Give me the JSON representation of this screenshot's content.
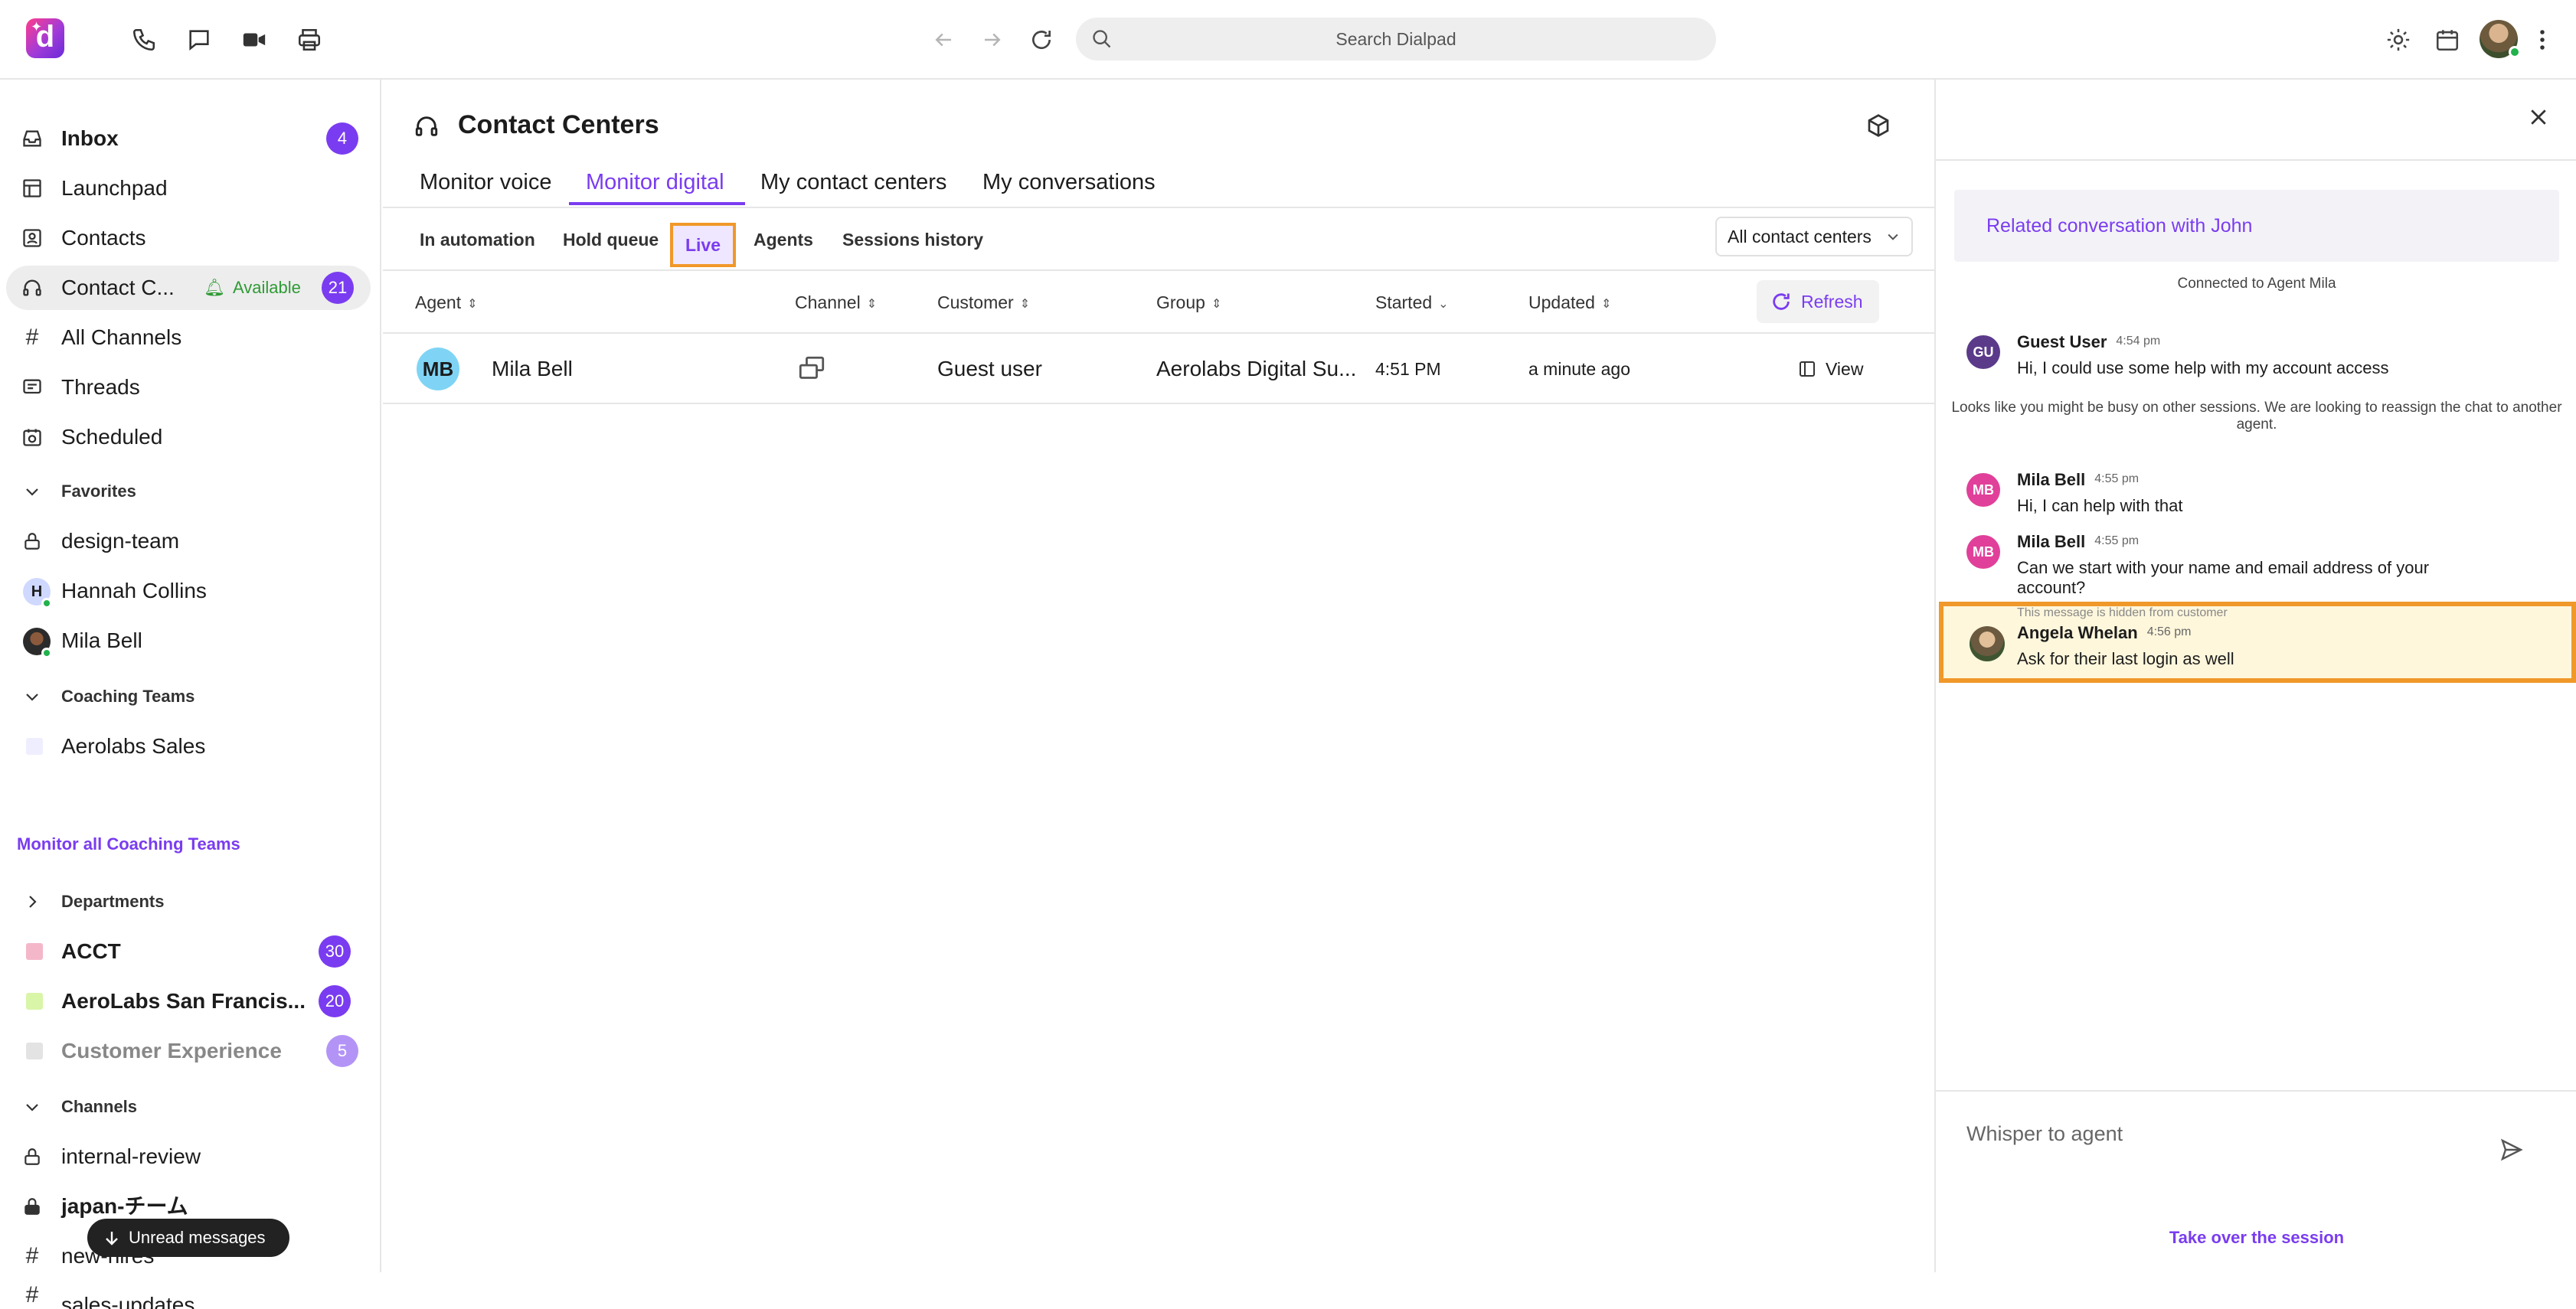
{
  "topbar": {
    "search_placeholder": "Search Dialpad",
    "logo_letter": "d",
    "icons": [
      "phone-icon",
      "message-icon",
      "video-icon",
      "print-icon",
      "back-icon",
      "forward-icon",
      "refresh-icon",
      "search-icon",
      "settings-icon",
      "calendar-icon",
      "more-icon"
    ]
  },
  "sidebar": {
    "items": [
      {
        "label": "Inbox",
        "badge": "4",
        "icon": "inbox-icon"
      },
      {
        "label": "Launchpad",
        "icon": "launchpad-icon"
      },
      {
        "label": "Contacts",
        "icon": "contacts-icon"
      },
      {
        "label": "Contact C...",
        "status": "Available",
        "badge": "21",
        "icon": "headset-icon"
      },
      {
        "label": "All Channels",
        "icon": "hash-icon"
      },
      {
        "label": "Threads",
        "icon": "threads-icon"
      },
      {
        "label": "Scheduled",
        "icon": "scheduled-icon"
      }
    ],
    "favorites": {
      "title": "Favorites",
      "items": [
        {
          "label": "design-team"
        },
        {
          "label": "Hannah Collins",
          "initial": "H"
        },
        {
          "label": "Mila Bell"
        }
      ]
    },
    "coaching": {
      "title": "Coaching Teams",
      "items": [
        {
          "label": "Aerolabs Sales"
        }
      ],
      "link": "Monitor all Coaching Teams"
    },
    "departments": {
      "title": "Departments",
      "items": [
        {
          "label": "ACCT",
          "badge": "30",
          "color": "#f4b7c9"
        },
        {
          "label": "AeroLabs San Francis...",
          "badge": "20",
          "color": "#d9f5a8"
        },
        {
          "label": "Customer Experience",
          "badge": "5",
          "color": "#e3e3e3"
        }
      ]
    },
    "channels": {
      "title": "Channels",
      "items": [
        {
          "label": "internal-review"
        },
        {
          "label": "japan-チーム"
        },
        {
          "label": "new-hires"
        },
        {
          "label": "sales-updates"
        }
      ]
    },
    "toast": "Unread messages"
  },
  "main": {
    "title": "Contact Centers",
    "tabs": [
      "Monitor voice",
      "Monitor digital",
      "My contact centers",
      "My conversations"
    ],
    "active_tab": "Monitor digital",
    "subtabs": [
      "In automation",
      "Hold queue",
      "Live",
      "Agents",
      "Sessions history"
    ],
    "active_subtab": "Live",
    "filter": "All contact centers",
    "columns": [
      "Agent",
      "Channel",
      "Customer",
      "Group",
      "Started",
      "Updated"
    ],
    "refresh_label": "Refresh",
    "rows": [
      {
        "agent_initials": "MB",
        "agent": "Mila Bell",
        "customer": "Guest user",
        "group": "Aerolabs Digital Su...",
        "started": "4:51 PM",
        "updated": "a minute ago",
        "action": "View"
      }
    ]
  },
  "panel": {
    "related": "Related conversation with John",
    "connected": "Connected to Agent Mila",
    "messages": [
      {
        "initials": "GU",
        "name": "Guest User",
        "time": "4:54 pm",
        "text": "Hi, I could use some help with my account access",
        "color": "#5b3a8a"
      },
      {
        "initials": "MB",
        "name": "Mila Bell",
        "time": "4:55 pm",
        "text": "Hi, I can help with that",
        "color": "#e0409a"
      },
      {
        "initials": "MB",
        "name": "Mila Bell",
        "time": "4:55 pm",
        "text": "Can we start with your name and email address of your account?",
        "color": "#e0409a"
      }
    ],
    "system_note": "Looks like you might be busy on other sessions. We are looking to reassign the chat to another agent.",
    "whisper": {
      "hidden_note": "This message is hidden from customer",
      "name": "Angela Whelan",
      "time": "4:56 pm",
      "text": "Ask for their last login as well"
    },
    "compose_placeholder": "Whisper to agent",
    "takeover": "Take over the session"
  },
  "colors": {
    "accent": "#7a3cf0",
    "highlight": "#f0982a",
    "available": "#2f9a35"
  }
}
